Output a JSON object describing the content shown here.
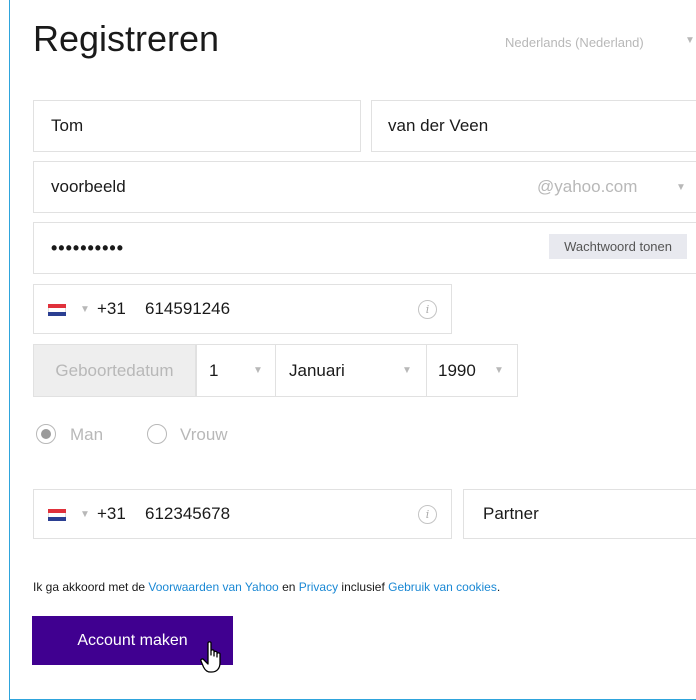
{
  "page": {
    "title": "Registreren",
    "language": "Nederlands (Nederland)"
  },
  "form": {
    "first_name": "Tom",
    "last_name": "van der Veen",
    "username": "voorbeeld",
    "domain": "@yahoo.com",
    "password_mask": "••••••••••",
    "show_password_label": "Wachtwoord tonen",
    "phone": {
      "country_code": "+31",
      "number": "614591246",
      "flag": "netherlands-flag-icon"
    },
    "birthdate": {
      "label": "Geboortedatum",
      "day": "1",
      "month": "Januari",
      "year": "1990"
    },
    "gender": {
      "options": [
        "Man",
        "Vrouw"
      ],
      "selected": "Man"
    },
    "recovery_phone": {
      "country_code": "+31",
      "number": "612345678"
    },
    "relationship": "Partner"
  },
  "terms": {
    "prefix": "Ik ga akkoord met de ",
    "link1": "Voorwaarden van Yahoo",
    "mid1": " en ",
    "link2": "Privacy",
    "mid2": " inclusief ",
    "link3": "Gebruik van cookies",
    "suffix": "."
  },
  "submit_label": "Account maken",
  "colors": {
    "accent": "#400090",
    "link": "#1a88d4",
    "border": "#2ea4dc"
  }
}
